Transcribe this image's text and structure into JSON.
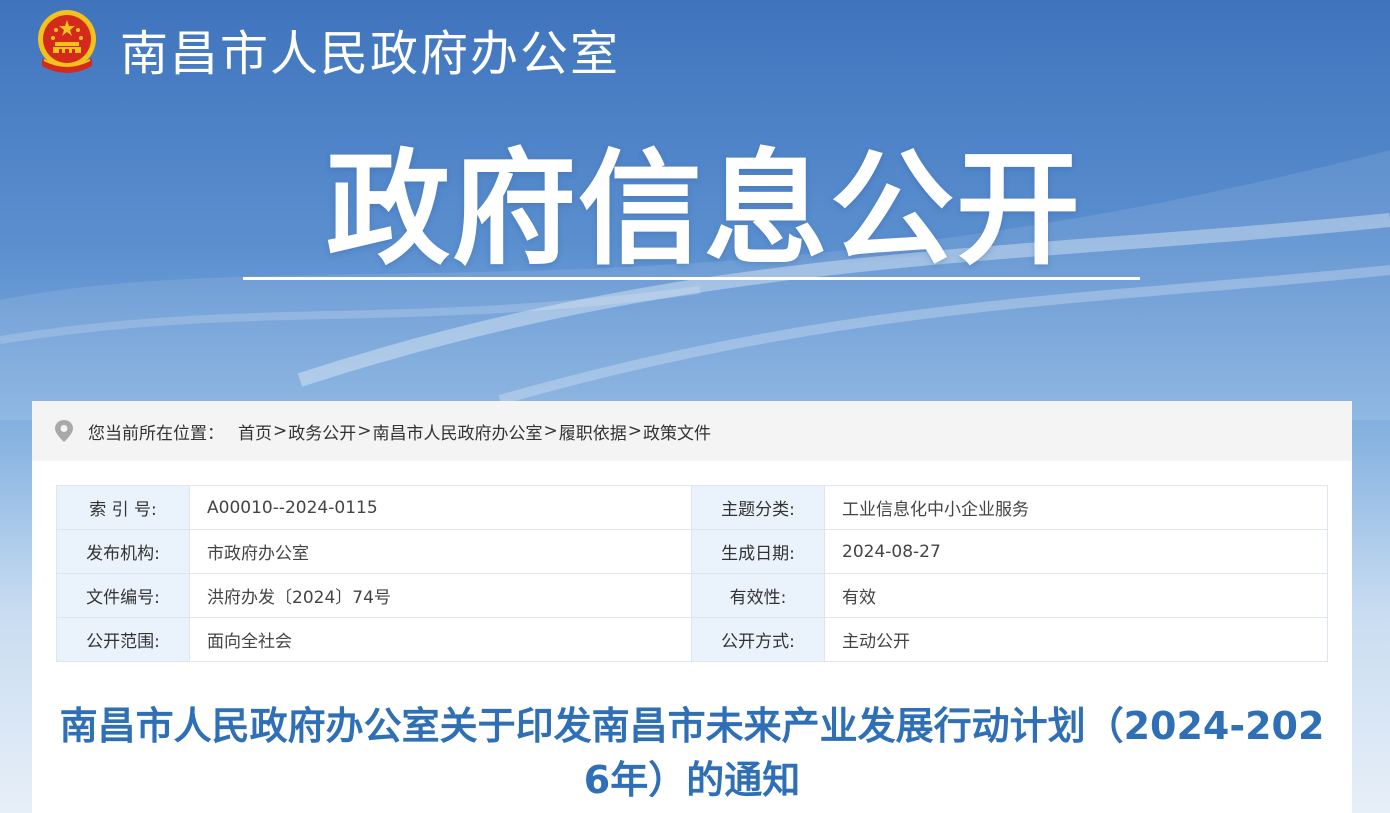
{
  "header": {
    "site_title": "南昌市人民政府办公室",
    "emblem_icon": "national-emblem-icon"
  },
  "banner": {
    "title": "政府信息公开"
  },
  "breadcrumb": {
    "label": "您当前所在位置：",
    "items": [
      "首页",
      "政务公开",
      "南昌市人民政府办公室",
      "履职依据",
      "政策文件"
    ],
    "separator": ">"
  },
  "meta": {
    "rows": [
      {
        "label1": "索 引 号:",
        "value1": "A00010--2024-0115",
        "label2": "主题分类:",
        "value2": "工业信息化中小企业服务"
      },
      {
        "label1": "发布机构:",
        "value1": "市政府办公室",
        "label2": "生成日期:",
        "value2": "2024-08-27"
      },
      {
        "label1": "文件编号:",
        "value1": "洪府办发〔2024〕74号",
        "label2": "有效性:",
        "value2": "有效"
      },
      {
        "label1": "公开范围:",
        "value1": "面向全社会",
        "label2": "公开方式:",
        "value2": "主动公开"
      }
    ]
  },
  "document": {
    "title": "南昌市人民政府办公室关于印发南昌市未来产业发展行动计划（2024-2026年）的通知"
  },
  "colors": {
    "accent": "#2f6fb5",
    "label_bg": "#eaf3fc",
    "emblem_red": "#d42a1c",
    "emblem_gold": "#f3c21b"
  }
}
